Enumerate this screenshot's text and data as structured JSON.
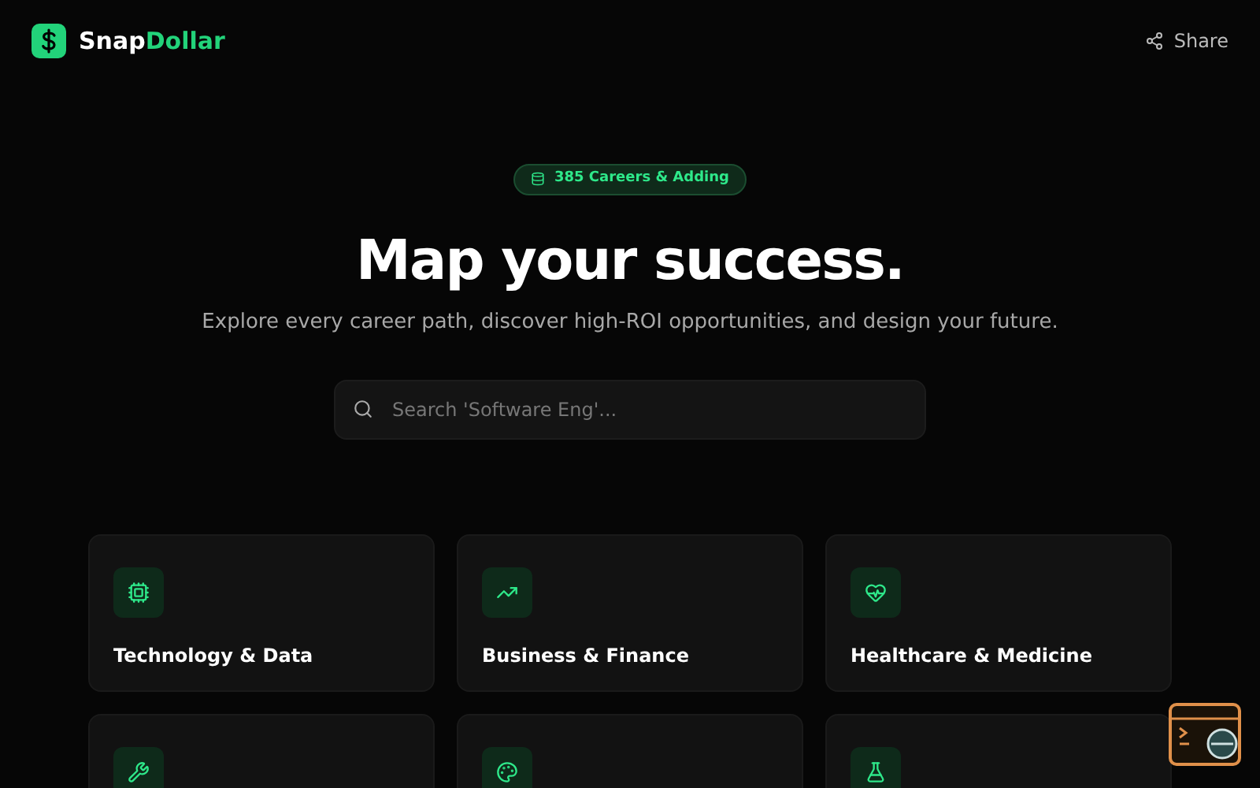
{
  "brand": {
    "name_start": "Snap",
    "name_end": "Dollar"
  },
  "header": {
    "share": "Share"
  },
  "hero": {
    "badge": "385 Careers & Adding",
    "title": "Map your success.",
    "subtitle": "Explore every career path, discover high-ROI opportunities, and design your future."
  },
  "search": {
    "placeholder": "Search 'Software Eng'..."
  },
  "categories": [
    {
      "kind": "full",
      "title": "Technology & Data"
    },
    {
      "kind": "full",
      "title": "Business & Finance"
    },
    {
      "kind": "full",
      "title": "Healthcare & Medicine"
    },
    {
      "kind": "cropped"
    },
    {
      "kind": "cropped"
    },
    {
      "kind": "cropped"
    }
  ]
}
